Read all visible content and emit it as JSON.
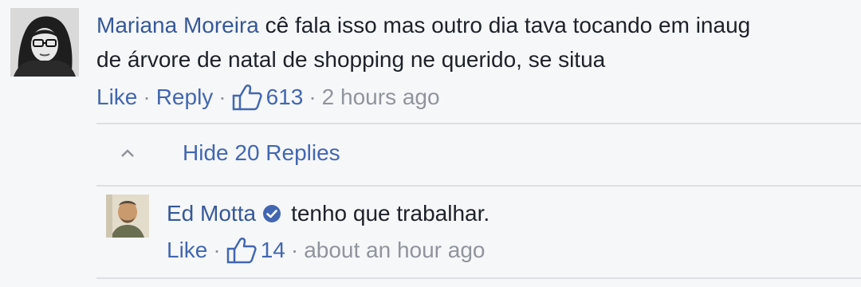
{
  "comment": {
    "author": "Mariana Moreira",
    "text_line1": "cê fala isso mas outro dia tava tocando em inaug",
    "text_line2": "de árvore de natal de shopping ne querido, se situa",
    "like_label": "Like",
    "reply_label": "Reply",
    "reaction_count": "613",
    "timestamp": "2 hours ago",
    "separator": "·"
  },
  "replies_toggle": {
    "label": "Hide 20 Replies",
    "icon": "chevron-up-icon"
  },
  "reply": {
    "author": "Ed Motta",
    "verified_icon": "verified-badge-icon",
    "text": "tenho que trabalhar.",
    "like_label": "Like",
    "reaction_count": "14",
    "timestamp": "about an hour ago",
    "separator": "·"
  },
  "colors": {
    "link": "#365899",
    "action": "#4267b2",
    "meta": "#90949c",
    "text": "#1d2129",
    "background": "#f6f7f9",
    "verified": "#4267b2"
  }
}
